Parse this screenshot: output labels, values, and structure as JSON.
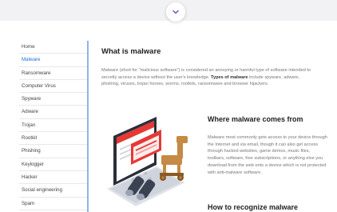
{
  "sidebar": {
    "items": [
      {
        "label": "Home"
      },
      {
        "label": "Malware"
      },
      {
        "label": "Ransomware"
      },
      {
        "label": "Computer Virus"
      },
      {
        "label": "Spyware"
      },
      {
        "label": "Adware"
      },
      {
        "label": "Trojan"
      },
      {
        "label": "Rootkit"
      },
      {
        "label": "Phishing"
      },
      {
        "label": "Keylogger"
      },
      {
        "label": "Hacker"
      },
      {
        "label": "Social engineering"
      },
      {
        "label": "Spam"
      }
    ],
    "active_index": 1
  },
  "article": {
    "section1": {
      "title": "What is malware",
      "body_before": "Malware (short for \"malicious software\") is considered an annoying or harmful type of software intended to secretly access a device without the user's knowledge. ",
      "body_bold": "Types of malware",
      "body_after": " include spyware, adware, phishing, viruses, trojan horses, worms, rootkits, ransomware and browser hijackers."
    },
    "section2": {
      "title": "Where malware comes from",
      "body": "Malware most commonly gets access to your device through the Internet and via email, though it can also get access through hacked websites, game demos, music files, toolbars, software, free subscriptions, or anything else you download from the web onto a device which is not protected with anti-malware software."
    },
    "section3": {
      "title": "How to recognize malware"
    }
  },
  "icons": {
    "scroll_down": "chevron-down-icon",
    "illustration": "laptop-trojan-horse-illustration"
  },
  "colors": {
    "accent": "#1e6fd9",
    "divider": "#8fb3e8",
    "chevron": "#7b3fd4",
    "warning_red": "#e53935"
  }
}
